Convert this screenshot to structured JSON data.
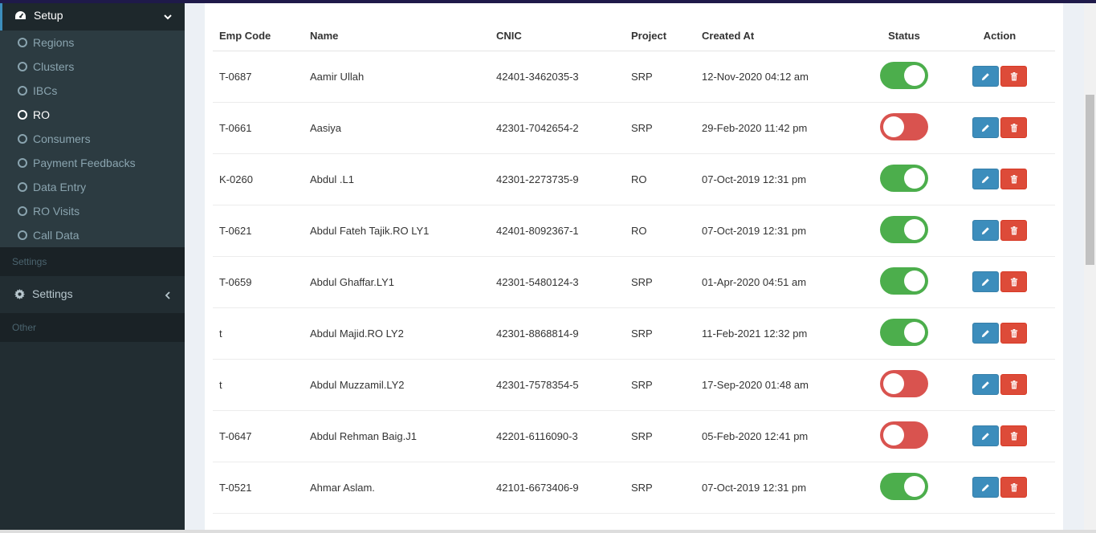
{
  "sidebar": {
    "setup_label": "Setup",
    "items": [
      {
        "label": "Regions",
        "active": false
      },
      {
        "label": "Clusters",
        "active": false
      },
      {
        "label": "IBCs",
        "active": false
      },
      {
        "label": "RO",
        "active": true
      },
      {
        "label": "Consumers",
        "active": false
      },
      {
        "label": "Payment Feedbacks",
        "active": false
      },
      {
        "label": "Data Entry",
        "active": false
      },
      {
        "label": "RO Visits",
        "active": false
      },
      {
        "label": "Call Data",
        "active": false
      }
    ],
    "settings_header": "Settings",
    "settings_label": "Settings",
    "other_header": "Other"
  },
  "table": {
    "headers": {
      "emp_code": "Emp Code",
      "name": "Name",
      "cnic": "CNIC",
      "project": "Project",
      "created_at": "Created At",
      "status": "Status",
      "action": "Action"
    },
    "rows": [
      {
        "emp_code": "T-0687",
        "name": "Aamir Ullah",
        "cnic": "42401-3462035-3",
        "project": "SRP",
        "created_at": "12-Nov-2020 04:12 am",
        "status": "on"
      },
      {
        "emp_code": "T-0661",
        "name": "Aasiya",
        "cnic": "42301-7042654-2",
        "project": "SRP",
        "created_at": "29-Feb-2020 11:42 pm",
        "status": "off"
      },
      {
        "emp_code": "K-0260",
        "name": "Abdul .L1",
        "cnic": "42301-2273735-9",
        "project": "RO",
        "created_at": "07-Oct-2019 12:31 pm",
        "status": "on"
      },
      {
        "emp_code": "T-0621",
        "name": "Abdul Fateh Tajik.RO LY1",
        "cnic": "42401-8092367-1",
        "project": "RO",
        "created_at": "07-Oct-2019 12:31 pm",
        "status": "on"
      },
      {
        "emp_code": "T-0659",
        "name": "Abdul Ghaffar.LY1",
        "cnic": "42301-5480124-3",
        "project": "SRP",
        "created_at": "01-Apr-2020 04:51 am",
        "status": "on"
      },
      {
        "emp_code": "t",
        "name": "Abdul Majid.RO LY2",
        "cnic": "42301-8868814-9",
        "project": "SRP",
        "created_at": "11-Feb-2021 12:32 pm",
        "status": "on"
      },
      {
        "emp_code": "t",
        "name": "Abdul Muzzamil.LY2",
        "cnic": "42301-7578354-5",
        "project": "SRP",
        "created_at": "17-Sep-2020 01:48 am",
        "status": "off"
      },
      {
        "emp_code": "T-0647",
        "name": "Abdul Rehman Baig.J1",
        "cnic": "42201-6116090-3",
        "project": "SRP",
        "created_at": "05-Feb-2020 12:41 pm",
        "status": "off"
      },
      {
        "emp_code": "T-0521",
        "name": "Ahmar Aslam.",
        "cnic": "42101-6673406-9",
        "project": "SRP",
        "created_at": "07-Oct-2019 12:31 pm",
        "status": "on"
      }
    ]
  },
  "colors": {
    "sidebar_bg": "#222d32",
    "toggle_on": "#4cae4c",
    "toggle_off": "#d9534f",
    "edit_button": "#3c8dbc",
    "delete_button": "#dd4b39"
  }
}
